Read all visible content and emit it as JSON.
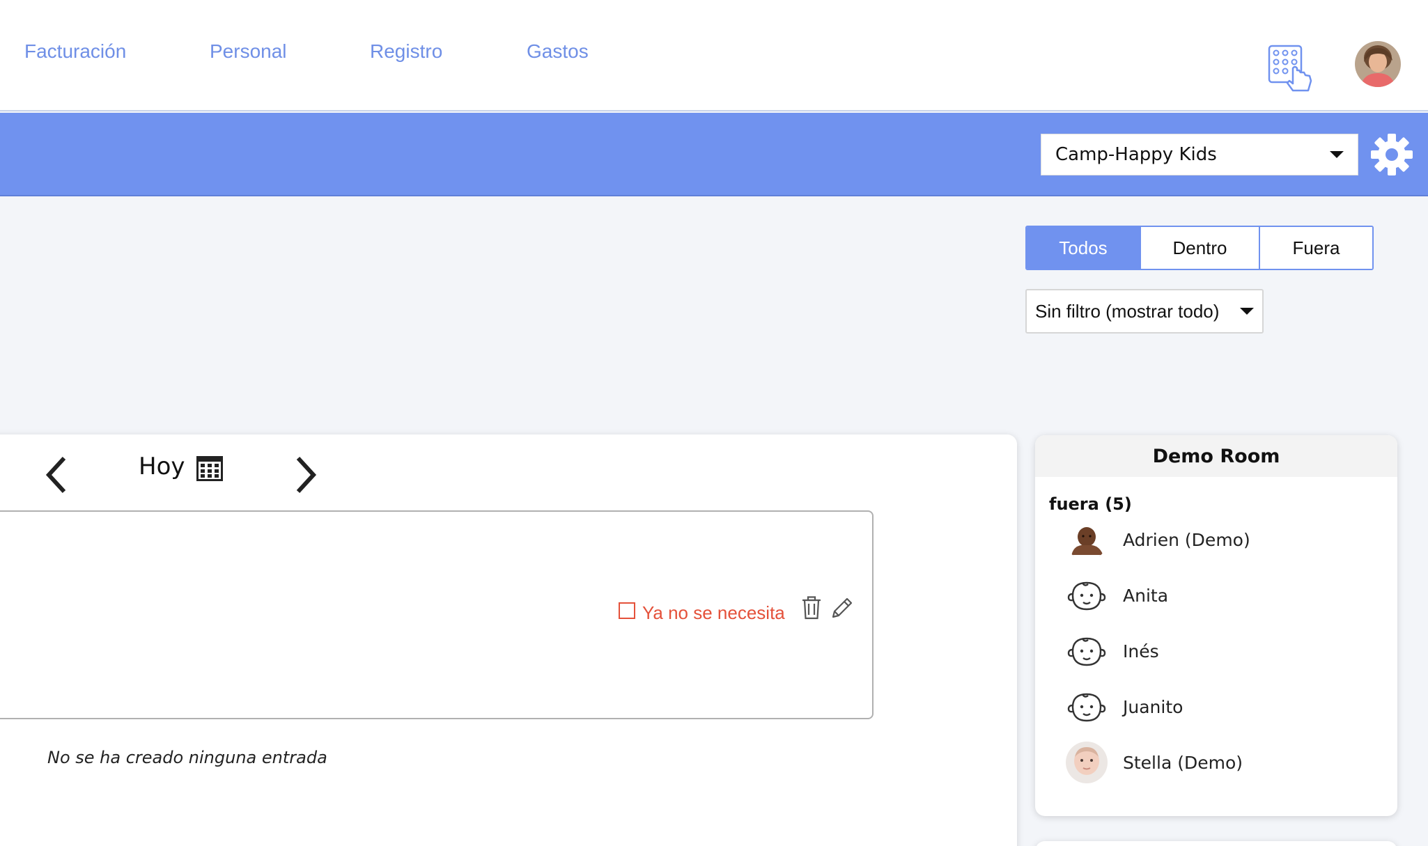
{
  "nav": {
    "items": [
      "Facturación",
      "Personal",
      "Registro",
      "Gastos"
    ]
  },
  "header": {
    "kiosk_icon": "keypad-touch-icon",
    "avatar_icon": "user-avatar",
    "school_select": "Camp-Happy Kids",
    "settings_icon": "gear-icon",
    "accent_color": "#7092ef"
  },
  "filters": {
    "segments": [
      "Todos",
      "Dentro",
      "Fuera"
    ],
    "active_segment": "Todos",
    "dropdown_value": "Sin filtro (mostrar todo)"
  },
  "day_nav": {
    "label": "Hoy",
    "prev_icon": "chevron-left-icon",
    "next_icon": "chevron-right-icon",
    "calendar_icon": "calendar-icon"
  },
  "entry": {
    "checkbox_label": "Ya no se necesita",
    "status_color": "#e4513a",
    "delete_icon": "trash-icon",
    "edit_icon": "pencil-icon",
    "empty_message": "No se ha creado ninguna entrada"
  },
  "room": {
    "title": "Demo Room",
    "group_label": "fuera (5)",
    "children": [
      {
        "name": "Adrien (Demo)",
        "avatar": "photo-baby-dark"
      },
      {
        "name": "Anita",
        "avatar": "baby-face-icon"
      },
      {
        "name": "Inés",
        "avatar": "baby-face-icon"
      },
      {
        "name": "Juanito",
        "avatar": "baby-face-icon"
      },
      {
        "name": "Stella (Demo)",
        "avatar": "photo-baby-light"
      }
    ]
  }
}
